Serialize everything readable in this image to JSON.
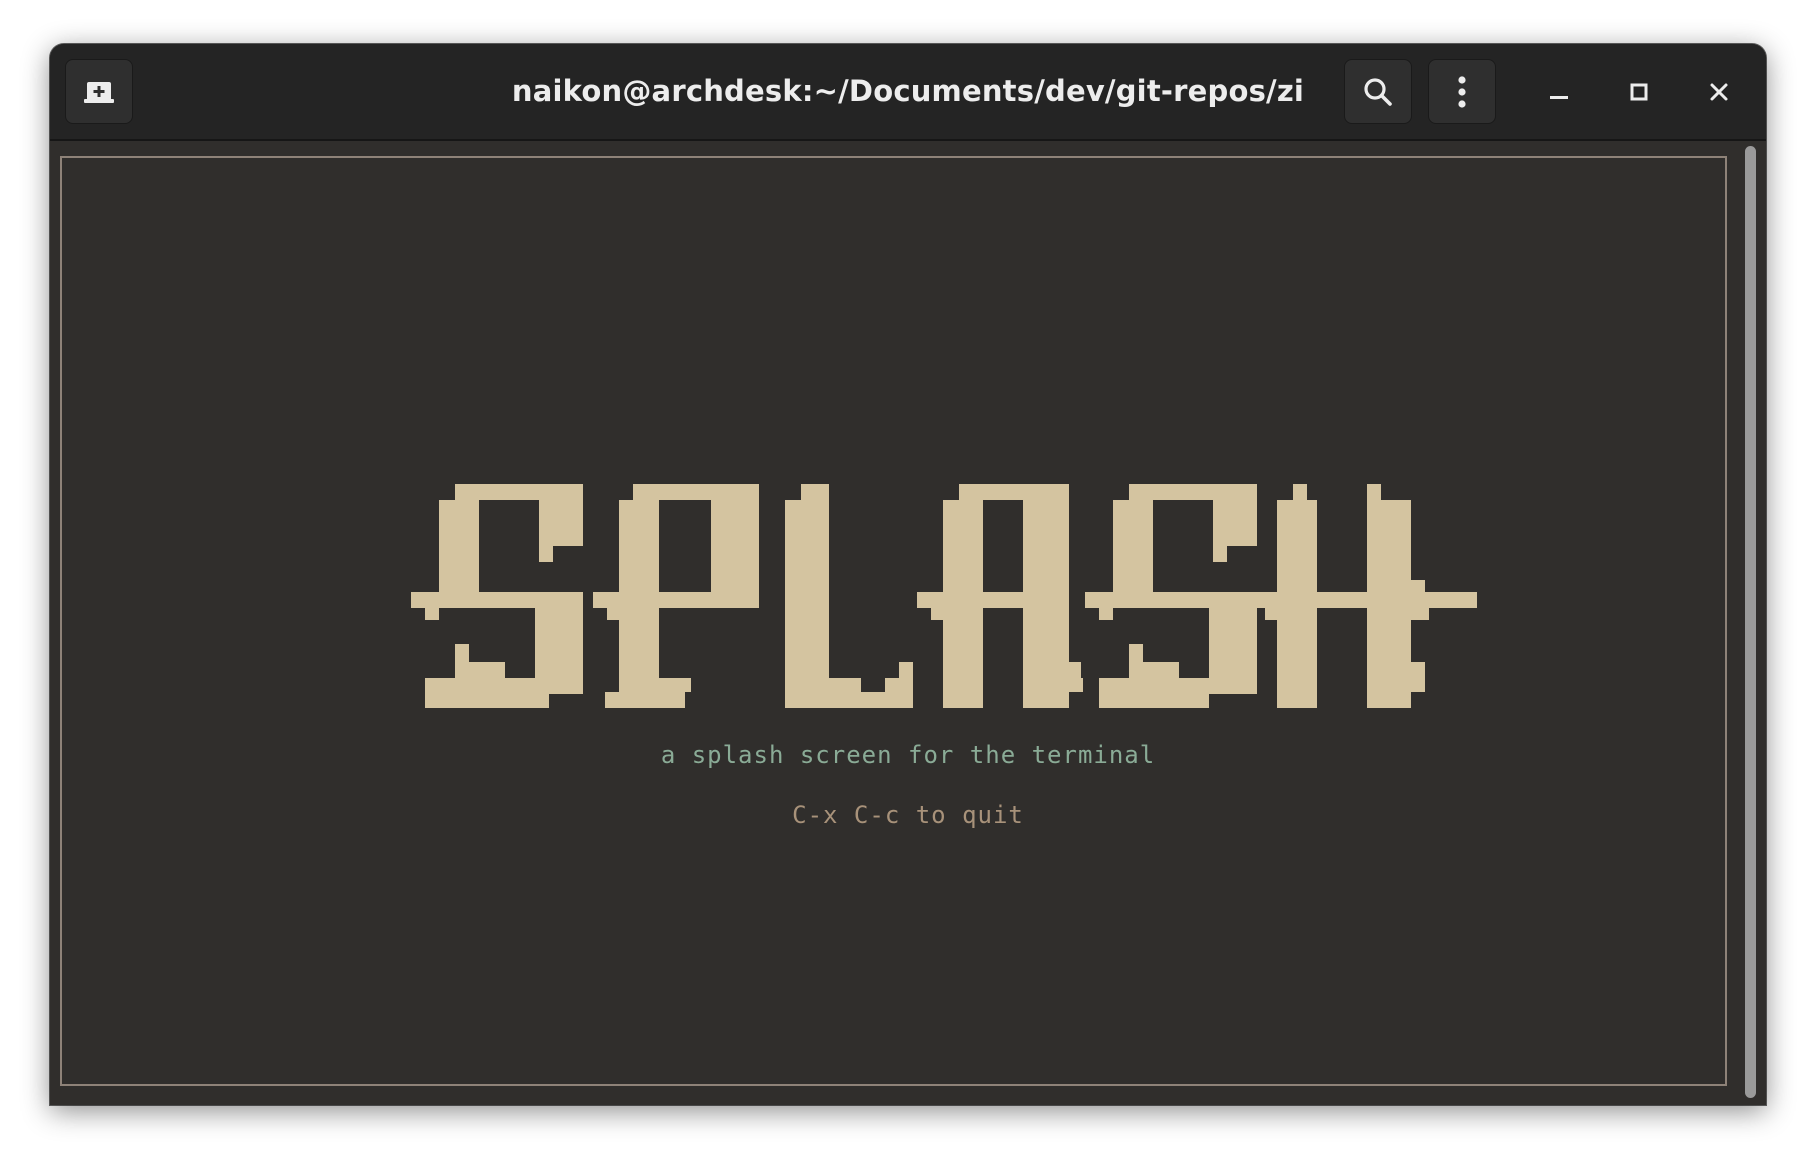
{
  "window": {
    "title": "naikon@archdesk:~/Documents/dev/git-repos/zi"
  },
  "header": {
    "new_tab_icon": "new-tab-icon",
    "search_icon": "search-icon",
    "menu_icon": "kebab-menu-icon"
  },
  "window_controls": {
    "minimize_icon": "minimize-icon",
    "maximize_icon": "maximize-icon",
    "close_icon": "close-icon"
  },
  "splash": {
    "logo_text": "SPLASH",
    "subtitle": "a splash screen for the terminal",
    "hint": "C-x C-c to quit"
  },
  "colors": {
    "logo": "#d4c4a0",
    "subtitle": "#8aab96",
    "hint": "#a8927a",
    "frame": "#8e8278",
    "background": "#302e2c",
    "titlebar": "#242424"
  }
}
